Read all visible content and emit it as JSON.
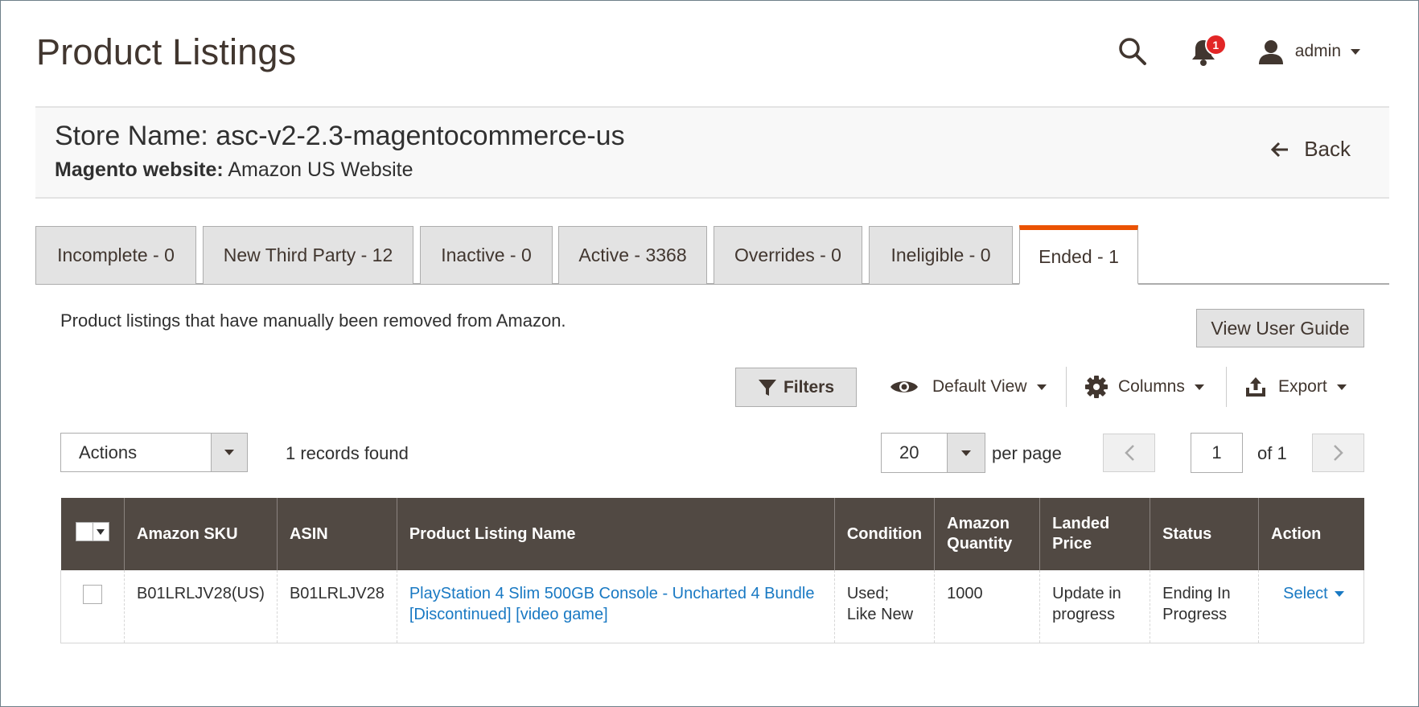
{
  "header": {
    "title": "Product Listings",
    "notification_count": "1",
    "user_name": "admin"
  },
  "store": {
    "name": "Store Name: asc-v2-2.3-magentocommerce-us",
    "website_label": "Magento website:",
    "website_value": "Amazon US Website",
    "back_label": "Back"
  },
  "tabs": [
    {
      "label": "Incomplete - 0",
      "active": false
    },
    {
      "label": "New Third Party - 12",
      "active": false
    },
    {
      "label": "Inactive - 0",
      "active": false
    },
    {
      "label": "Active - 3368",
      "active": false
    },
    {
      "label": "Overrides - 0",
      "active": false
    },
    {
      "label": "Ineligible - 0",
      "active": false
    },
    {
      "label": "Ended - 1",
      "active": true
    }
  ],
  "description": "Product listings that have manually been removed from Amazon.",
  "view_user_guide": "View User Guide",
  "toolbar": {
    "filters": "Filters",
    "default_view": "Default View",
    "columns": "Columns",
    "export": "Export"
  },
  "actions": {
    "label": "Actions",
    "records_found": "1 records found"
  },
  "pagination": {
    "per_page_value": "20",
    "per_page_label": "per page",
    "current_page": "1",
    "of_label": "of 1"
  },
  "grid": {
    "columns": [
      "Amazon SKU",
      "ASIN",
      "Product Listing Name",
      "Condition",
      "Amazon Quantity",
      "Landed Price",
      "Status",
      "Action"
    ],
    "rows": [
      {
        "sku": "B01LRLJV28(US)",
        "asin": "B01LRLJV28",
        "name": "PlayStation 4 Slim 500GB Console - Uncharted 4 Bundle [Discontinued] [video game]",
        "condition": "Used; Like New",
        "quantity": "1000",
        "landed_price": "Update in progress",
        "status": "Ending In Progress",
        "action": "Select"
      }
    ]
  },
  "colors": {
    "accent": "#eb5202",
    "grid_header": "#514943",
    "link": "#1979c3",
    "badge": "#e22626"
  }
}
